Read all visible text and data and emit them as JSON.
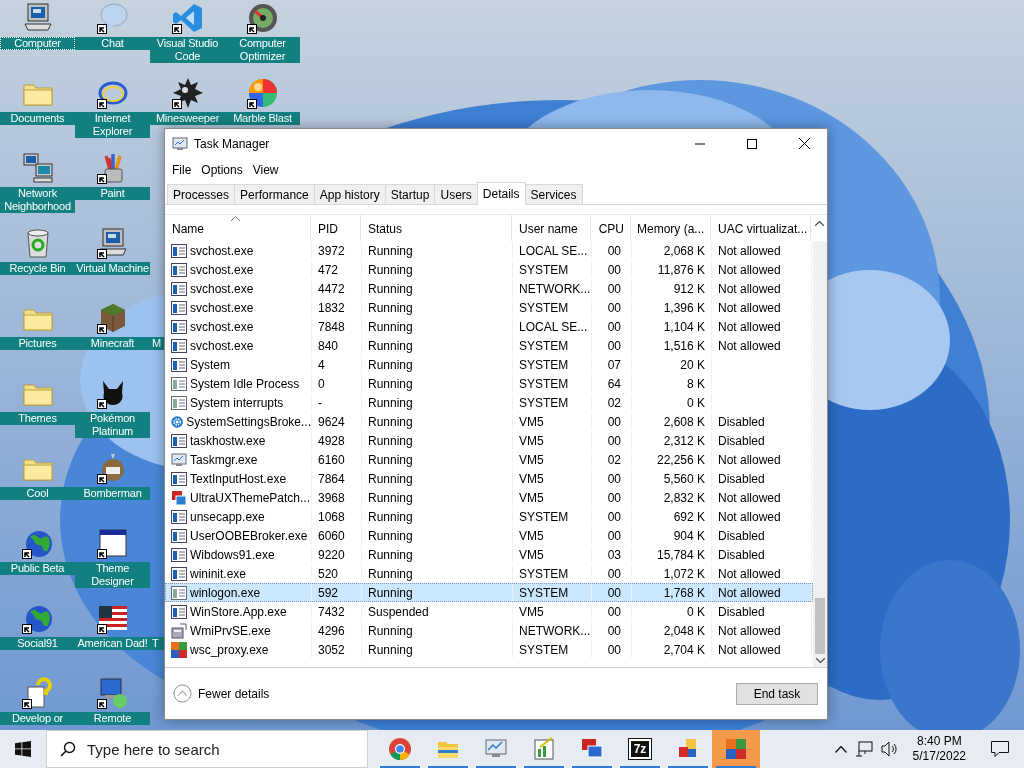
{
  "desktop_rows": [
    [
      {
        "label": "Computer",
        "kind": "computer",
        "shortcut": false,
        "focused": true
      },
      {
        "label": "Chat",
        "kind": "bubble",
        "shortcut": true,
        "focused": false
      },
      {
        "label": "Visual Studio Code",
        "kind": "code",
        "shortcut": true,
        "focused": false
      },
      {
        "label": "Computer Optimizer",
        "kind": "gauge",
        "shortcut": true,
        "focused": false
      }
    ],
    [
      {
        "label": "Documents",
        "kind": "folder",
        "shortcut": false,
        "focused": false
      },
      {
        "label": "Internet Explorer",
        "kind": "ring",
        "shortcut": true,
        "focused": false
      },
      {
        "label": "Minesweeper",
        "kind": "mine",
        "shortcut": true,
        "focused": false
      },
      {
        "label": "Marble Blast",
        "kind": "ball",
        "shortcut": true,
        "focused": false
      }
    ],
    [
      {
        "label": "Network Neighborhood",
        "kind": "network",
        "shortcut": false,
        "focused": false
      },
      {
        "label": "Paint",
        "kind": "pencils",
        "shortcut": true,
        "focused": false
      }
    ],
    [
      {
        "label": "Recycle Bin",
        "kind": "bin",
        "shortcut": false,
        "focused": false
      },
      {
        "label": "Virtual Machine",
        "kind": "computer",
        "shortcut": true,
        "focused": false
      }
    ],
    [
      {
        "label": "Pictures",
        "kind": "folder",
        "shortcut": false,
        "focused": false
      },
      {
        "label": "Minecraft",
        "kind": "block",
        "shortcut": true,
        "focused": false
      },
      {
        "label": "M",
        "focused": false
      }
    ],
    [
      {
        "label": "Themes",
        "kind": "folder",
        "shortcut": false,
        "focused": false
      },
      {
        "label": "Pokémon Platinum",
        "kind": "creature",
        "shortcut": true,
        "focused": false
      }
    ],
    [
      {
        "label": "Cool",
        "kind": "folder",
        "shortcut": false,
        "focused": false
      },
      {
        "label": "Bomberman",
        "kind": "figure",
        "shortcut": true,
        "focused": false
      }
    ],
    [
      {
        "label": "Public Beta",
        "kind": "globe",
        "shortcut": true,
        "focused": false
      },
      {
        "label": "Theme Designer",
        "kind": "window",
        "shortcut": true,
        "focused": false
      }
    ],
    [
      {
        "label": "Social91",
        "kind": "globe",
        "shortcut": true,
        "focused": false
      },
      {
        "label": "American Dad!",
        "kind": "flag",
        "shortcut": true,
        "focused": false
      },
      {
        "label": "T",
        "focused": false
      }
    ],
    [
      {
        "label": "Develop or",
        "kind": "help",
        "shortcut": true,
        "focused": false
      },
      {
        "label": "Remote",
        "kind": "remote",
        "shortcut": true,
        "focused": false
      }
    ]
  ],
  "task_manager": {
    "title": "Task Manager",
    "menu": [
      "File",
      "Options",
      "View"
    ],
    "tabs": [
      {
        "label": "Processes",
        "selected": false
      },
      {
        "label": "Performance",
        "selected": false
      },
      {
        "label": "App history",
        "selected": false
      },
      {
        "label": "Startup",
        "selected": false
      },
      {
        "label": "Users",
        "selected": false
      },
      {
        "label": "Details",
        "selected": true
      },
      {
        "label": "Services",
        "selected": false
      }
    ],
    "columns": [
      {
        "label": "Name",
        "sorted": true
      },
      {
        "label": "PID",
        "sorted": false
      },
      {
        "label": "Status",
        "sorted": false
      },
      {
        "label": "User name",
        "sorted": false
      },
      {
        "label": "CPU",
        "sorted": false
      },
      {
        "label": "Memory (a...",
        "sorted": false
      },
      {
        "label": "UAC virtualizat...",
        "sorted": false
      }
    ],
    "rows": [
      {
        "kind": "app",
        "name": "svchost.exe",
        "pid": "3972",
        "status": "Running",
        "user": "LOCAL SE...",
        "cpu": "00",
        "memory": "2,068 K",
        "uac": "Not allowed",
        "selected": false
      },
      {
        "kind": "app",
        "name": "svchost.exe",
        "pid": "472",
        "status": "Running",
        "user": "SYSTEM",
        "cpu": "00",
        "memory": "11,876 K",
        "uac": "Not allowed",
        "selected": false
      },
      {
        "kind": "app",
        "name": "svchost.exe",
        "pid": "4472",
        "status": "Running",
        "user": "NETWORK...",
        "cpu": "00",
        "memory": "912 K",
        "uac": "Not allowed",
        "selected": false
      },
      {
        "kind": "app",
        "name": "svchost.exe",
        "pid": "1832",
        "status": "Running",
        "user": "SYSTEM",
        "cpu": "00",
        "memory": "1,396 K",
        "uac": "Not allowed",
        "selected": false
      },
      {
        "kind": "app",
        "name": "svchost.exe",
        "pid": "7848",
        "status": "Running",
        "user": "LOCAL SE...",
        "cpu": "00",
        "memory": "1,104 K",
        "uac": "Not allowed",
        "selected": false
      },
      {
        "kind": "app",
        "name": "svchost.exe",
        "pid": "840",
        "status": "Running",
        "user": "SYSTEM",
        "cpu": "00",
        "memory": "1,516 K",
        "uac": "Not allowed",
        "selected": false
      },
      {
        "kind": "app",
        "name": "System",
        "pid": "4",
        "status": "Running",
        "user": "SYSTEM",
        "cpu": "07",
        "memory": "20 K",
        "selected": false
      },
      {
        "kind": "sysapp",
        "name": "System Idle Process",
        "pid": "0",
        "status": "Running",
        "user": "SYSTEM",
        "cpu": "64",
        "memory": "8 K",
        "selected": false
      },
      {
        "kind": "sysapp",
        "name": "System interrupts",
        "pid": "-",
        "status": "Running",
        "user": "SYSTEM",
        "cpu": "02",
        "memory": "0 K",
        "selected": false
      },
      {
        "kind": "gear",
        "name": "SystemSettingsBroke...",
        "pid": "9624",
        "status": "Running",
        "user": "VM5",
        "cpu": "00",
        "memory": "2,608 K",
        "uac": "Disabled",
        "selected": false
      },
      {
        "kind": "app",
        "name": "taskhostw.exe",
        "pid": "4928",
        "status": "Running",
        "user": "VM5",
        "cpu": "00",
        "memory": "2,312 K",
        "uac": "Disabled",
        "selected": false
      },
      {
        "kind": "monitor",
        "name": "Taskmgr.exe",
        "pid": "6160",
        "status": "Running",
        "user": "VM5",
        "cpu": "02",
        "memory": "22,256 K",
        "uac": "Not allowed",
        "selected": false
      },
      {
        "kind": "app",
        "name": "TextInputHost.exe",
        "pid": "7864",
        "status": "Running",
        "user": "VM5",
        "cpu": "00",
        "memory": "5,560 K",
        "uac": "Disabled",
        "selected": false
      },
      {
        "kind": "patch",
        "name": "UltraUXThemePatch...",
        "pid": "3968",
        "status": "Running",
        "user": "VM5",
        "cpu": "00",
        "memory": "2,832 K",
        "uac": "Not allowed",
        "selected": false
      },
      {
        "kind": "app",
        "name": "unsecapp.exe",
        "pid": "1068",
        "status": "Running",
        "user": "SYSTEM",
        "cpu": "00",
        "memory": "692 K",
        "uac": "Not allowed",
        "selected": false
      },
      {
        "kind": "app",
        "name": "UserOOBEBroker.exe",
        "pid": "6060",
        "status": "Running",
        "user": "VM5",
        "cpu": "00",
        "memory": "904 K",
        "uac": "Disabled",
        "selected": false
      },
      {
        "kind": "app",
        "name": "Wibdows91.exe",
        "pid": "9220",
        "status": "Running",
        "user": "VM5",
        "cpu": "03",
        "memory": "15,784 K",
        "uac": "Disabled",
        "selected": false
      },
      {
        "kind": "app",
        "name": "wininit.exe",
        "pid": "520",
        "status": "Running",
        "user": "SYSTEM",
        "cpu": "00",
        "memory": "1,072 K",
        "uac": "Not allowed",
        "selected": false
      },
      {
        "kind": "sysapp",
        "name": "winlogon.exe",
        "pid": "592",
        "status": "Running",
        "user": "SYSTEM",
        "cpu": "00",
        "memory": "1,768 K",
        "uac": "Not allowed",
        "selected": true
      },
      {
        "kind": "app",
        "name": "WinStore.App.exe",
        "pid": "7432",
        "status": "Suspended",
        "user": "VM5",
        "cpu": "00",
        "memory": "0 K",
        "uac": "Disabled",
        "selected": false
      },
      {
        "kind": "wmi",
        "name": "WmiPrvSE.exe",
        "pid": "4296",
        "status": "Running",
        "user": "NETWORK...",
        "cpu": "00",
        "memory": "2,048 K",
        "uac": "Not allowed",
        "selected": false
      },
      {
        "kind": "squares",
        "name": "wsc_proxy.exe",
        "pid": "3052",
        "status": "Running",
        "user": "SYSTEM",
        "cpu": "00",
        "memory": "2,704 K",
        "uac": "Not allowed",
        "selected": false
      }
    ],
    "fewer_details": "Fewer details",
    "end_task": "End task"
  },
  "taskbar": {
    "search_placeholder": "Type here to search",
    "apps": [
      {
        "kind": "chrome",
        "running": true,
        "highlighted": false
      },
      {
        "kind": "folder",
        "running": true,
        "highlighted": false
      },
      {
        "kind": "monitor",
        "running": true,
        "highlighted": false
      },
      {
        "kind": "chart",
        "running": true,
        "highlighted": false
      },
      {
        "kind": "remote",
        "running": true,
        "highlighted": false
      },
      {
        "kind": "archive",
        "label": "7z",
        "running": true,
        "highlighted": false
      },
      {
        "kind": "tiles",
        "running": true,
        "highlighted": false
      },
      {
        "kind": "squares",
        "running": true,
        "highlighted": true
      }
    ],
    "time": "8:40 PM",
    "date": "5/17/2022"
  }
}
